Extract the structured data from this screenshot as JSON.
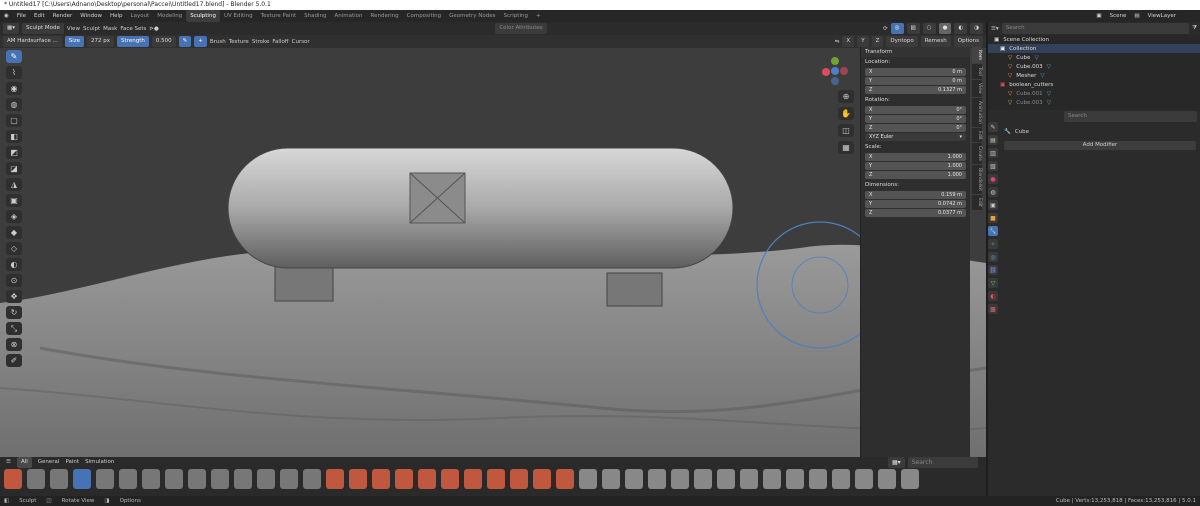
{
  "window_title": "* Untitled17 [C:\\Users\\Adnano\\Desktop\\personal\\Paccei\\Untitled17.blend] - Blender 5.0.1",
  "menu": [
    "File",
    "Edit",
    "Render",
    "Window",
    "Help"
  ],
  "workspaces": [
    "Layout",
    "Modeling",
    "Sculpting",
    "UV Editing",
    "Texture Paint",
    "Shading",
    "Animation",
    "Rendering",
    "Compositing",
    "Geometry Nodes",
    "Scripting"
  ],
  "active_workspace": "Sculpting",
  "scene_label": "Scene",
  "viewlayer_label": "ViewLayer",
  "viewport_header": {
    "mode": "Sculpt Mode",
    "menus": [
      "View",
      "Sculpt",
      "Mask",
      "Face Sets"
    ],
    "brush_name": "AM Hardsurface ...",
    "size_label": "Size",
    "size_value": "272 px",
    "strength_label": "Strength",
    "strength_value": "0.500",
    "dropdowns": [
      "Brush",
      "Texture",
      "Stroke",
      "Falloff",
      "Cursor"
    ],
    "color_attributes": "Color Attributes",
    "dyntopo": "Dyntopo",
    "remesh": "Remesh",
    "options": "Options",
    "axes": [
      "X",
      "Y",
      "Z"
    ]
  },
  "transform": {
    "header": "Transform",
    "location_label": "Location:",
    "location": [
      {
        "axis": "X",
        "value": "0 m"
      },
      {
        "axis": "Y",
        "value": "0 m"
      },
      {
        "axis": "Z",
        "value": "0.1327 m"
      }
    ],
    "rotation_label": "Rotation:",
    "rotation": [
      {
        "axis": "X",
        "value": "0°"
      },
      {
        "axis": "Y",
        "value": "0°"
      },
      {
        "axis": "Z",
        "value": "0°"
      }
    ],
    "rotation_mode": "XYZ Euler",
    "scale_label": "Scale:",
    "scale": [
      {
        "axis": "X",
        "value": "1.000"
      },
      {
        "axis": "Y",
        "value": "1.000"
      },
      {
        "axis": "Z",
        "value": "1.000"
      }
    ],
    "dimensions_label": "Dimensions:",
    "dimensions": [
      {
        "axis": "X",
        "value": "0.159 m"
      },
      {
        "axis": "Y",
        "value": "0.0742 m"
      },
      {
        "axis": "Z",
        "value": "0.0377 m"
      }
    ]
  },
  "side_tabs": [
    "Item",
    "Tool",
    "View",
    "Animation",
    "Edit",
    "Create",
    "Blenderkit",
    "Edit"
  ],
  "outliner": {
    "search_placeholder": "Search",
    "root": "Scene Collection",
    "rows": [
      "Collection",
      "Cube",
      "Cube.003",
      "Mesher",
      "boolean_cutters",
      "Cube.001",
      "Cube.003"
    ]
  },
  "properties": {
    "search_placeholder": "Search",
    "object_name": "Cube",
    "add_modifier": "Add Modifier"
  },
  "shelf": {
    "tabs": [
      "All",
      "General",
      "Paint",
      "Simulation"
    ],
    "search_placeholder": "Search"
  },
  "status_bar": {
    "left": [
      "Sculpt",
      "Rotate View",
      "Options"
    ],
    "right": "Cube | Verts:13,253,818 | Faces:13,253,816 | 5.0.1"
  }
}
